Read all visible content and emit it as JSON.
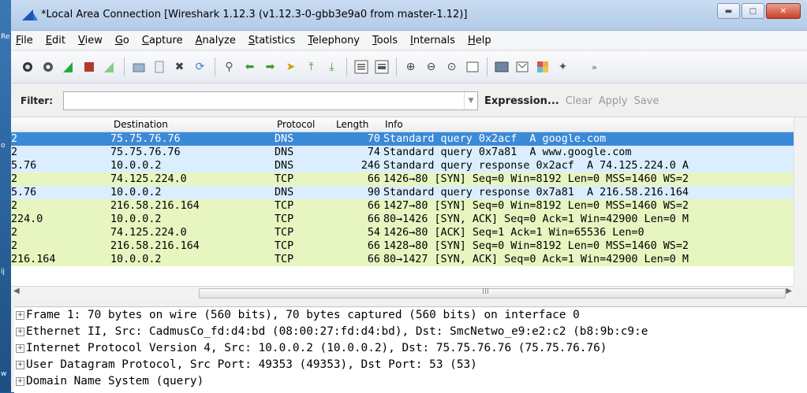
{
  "window": {
    "title": "*Local Area Connection  [Wireshark 1.12.3  (v1.12.3-0-gbb3e9a0 from master-1.12)]"
  },
  "menu": [
    "File",
    "Edit",
    "View",
    "Go",
    "Capture",
    "Analyze",
    "Statistics",
    "Telephony",
    "Tools",
    "Internals",
    "Help"
  ],
  "toolbar_icons": [
    "start-capture-icon",
    "capture-options-icon",
    "shark-fin-icon",
    "stop-icon",
    "restart-icon",
    "open-folder-icon",
    "save-file-icon",
    "close-file-icon",
    "reload-icon",
    "find-icon",
    "back-arrow-icon",
    "forward-arrow-icon",
    "go-to-packet-icon",
    "first-packet-icon",
    "last-packet-icon",
    "colorize-icon",
    "autoscroll-icon",
    "zoom-in-icon",
    "zoom-out-icon",
    "normal-size-icon",
    "resize-columns-icon",
    "capture-filters-icon",
    "display-filters-icon",
    "coloring-rules-icon",
    "preferences-icon",
    "more-icon"
  ],
  "filter": {
    "label": "Filter:",
    "value": "",
    "expression": "Expression...",
    "clear": "Clear",
    "apply": "Apply",
    "save": "Save"
  },
  "columns": {
    "destination": "Destination",
    "protocol": "Protocol",
    "length": "Length",
    "info": "Info"
  },
  "packets": [
    {
      "src": "2",
      "dst": "75.75.76.76",
      "proto": "DNS",
      "len": "70",
      "info": "Standard query 0x2acf  A google.com",
      "cls": "sel"
    },
    {
      "src": "2",
      "dst": "75.75.76.76",
      "proto": "DNS",
      "len": "74",
      "info": "Standard query 0x7a81  A www.google.com",
      "cls": "dns"
    },
    {
      "src": "5.76",
      "dst": "10.0.0.2",
      "proto": "DNS",
      "len": "246",
      "info": "Standard query response 0x2acf  A 74.125.224.0 A",
      "cls": "dns"
    },
    {
      "src": "2",
      "dst": "74.125.224.0",
      "proto": "TCP",
      "len": "66",
      "info": "1426→80 [SYN] Seq=0 Win=8192 Len=0 MSS=1460 WS=2",
      "cls": "tcp"
    },
    {
      "src": "5.76",
      "dst": "10.0.0.2",
      "proto": "DNS",
      "len": "90",
      "info": "Standard query response 0x7a81  A 216.58.216.164",
      "cls": "dns"
    },
    {
      "src": "2",
      "dst": "216.58.216.164",
      "proto": "TCP",
      "len": "66",
      "info": "1427→80 [SYN] Seq=0 Win=8192 Len=0 MSS=1460 WS=2",
      "cls": "tcp"
    },
    {
      "src": "224.0",
      "dst": "10.0.0.2",
      "proto": "TCP",
      "len": "66",
      "info": "80→1426 [SYN, ACK] Seq=0 Ack=1 Win=42900 Len=0 M",
      "cls": "tcp"
    },
    {
      "src": "2",
      "dst": "74.125.224.0",
      "proto": "TCP",
      "len": "54",
      "info": "1426→80 [ACK] Seq=1 Ack=1 Win=65536 Len=0",
      "cls": "tcp"
    },
    {
      "src": "2",
      "dst": "216.58.216.164",
      "proto": "TCP",
      "len": "66",
      "info": "1428→80 [SYN] Seq=0 Win=8192 Len=0 MSS=1460 WS=2",
      "cls": "tcp"
    },
    {
      "src": "216.164",
      "dst": "10.0.0.2",
      "proto": "TCP",
      "len": "66",
      "info": "80→1427 [SYN, ACK] Seq=0 Ack=1 Win=42900 Len=0 M",
      "cls": "tcp"
    }
  ],
  "details": [
    "Frame 1: 70 bytes on wire (560 bits), 70 bytes captured (560 bits) on interface 0",
    "Ethernet II, Src: CadmusCo_fd:d4:bd (08:00:27:fd:d4:bd), Dst: SmcNetwo_e9:e2:c2 (b8:9b:c9:e",
    "Internet Protocol Version 4, Src: 10.0.0.2 (10.0.0.2), Dst: 75.75.76.76 (75.75.76.76)",
    "User Datagram Protocol, Src Port: 49353 (49353), Dst Port: 53 (53)",
    "Domain Name System (query)"
  ],
  "scroll": {
    "h_mark": "III"
  },
  "desktop_letters": [
    "Re",
    "o",
    "ij",
    "w"
  ]
}
